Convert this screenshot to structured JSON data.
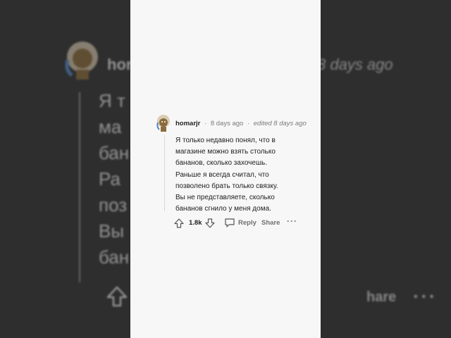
{
  "comment": {
    "username": "homarjr",
    "time_ago": "8 days ago",
    "edited": "edited 8 days ago",
    "separator": "·",
    "lines": [
      "Я только недавно понял, что в",
      "магазине можно взять столько",
      "бананов, сколько захочешь.",
      "Раньше я всегда считал, что",
      "позволено брать только связку.",
      "Вы не представляете, сколько",
      "бананов сгнило у меня дома."
    ],
    "votes": "1.8k",
    "reply_label": "Reply",
    "share_label": "Share",
    "more_label": "···"
  },
  "background": {
    "username_partial": "hor",
    "meta_partial": "8 days ago",
    "lines": [
      "Я т",
      "ма",
      "бан",
      "Ра",
      "поз",
      "Вы",
      "бан"
    ],
    "share_partial": "hare",
    "more_label": "···"
  },
  "colors": {
    "card": "#f7f7f7",
    "backdrop": "#2e2e2e",
    "text": "#1c1c1c",
    "meta": "#7a7a7a"
  },
  "icons": [
    "avatar",
    "upvote-icon",
    "downvote-icon",
    "reply-icon",
    "more-icon"
  ]
}
